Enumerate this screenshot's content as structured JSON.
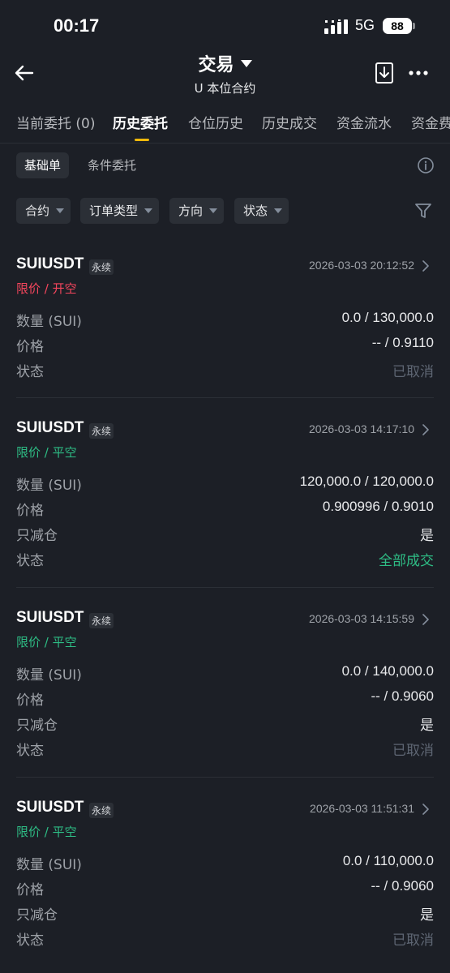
{
  "status_bar": {
    "time": "00:17",
    "network": "5G",
    "battery": "88"
  },
  "header": {
    "title": "交易",
    "subtitle": "U 本位合约"
  },
  "tabs": [
    {
      "label": "当前委托 (0)"
    },
    {
      "label": "历史委托"
    },
    {
      "label": "仓位历史"
    },
    {
      "label": "历史成交"
    },
    {
      "label": "资金流水"
    },
    {
      "label": "资金费"
    }
  ],
  "subtabs": [
    {
      "label": "基础单"
    },
    {
      "label": "条件委托"
    }
  ],
  "filters": [
    {
      "label": "合约"
    },
    {
      "label": "订单类型"
    },
    {
      "label": "方向"
    },
    {
      "label": "状态"
    }
  ],
  "labels": {
    "qty": "数量 (SUI)",
    "price": "价格",
    "reduce_only": "只减仓",
    "status": "状态"
  },
  "orders": [
    {
      "symbol": "SUIUSDT",
      "badge": "永续",
      "time": "2026-03-03 20:12:52",
      "type": "限价 / 开空",
      "type_color": "#f6465d",
      "qty": "0.0 / 130,000.0",
      "price": "-- / 0.9110",
      "reduce_only": "",
      "status": "已取消"
    },
    {
      "symbol": "SUIUSDT",
      "badge": "永续",
      "time": "2026-03-03 14:17:10",
      "type": "限价 / 平空",
      "type_color": "#2ebd85",
      "qty": "120,000.0 / 120,000.0",
      "price": "0.900996 / 0.9010",
      "reduce_only": "是",
      "status": "全部成交"
    },
    {
      "symbol": "SUIUSDT",
      "badge": "永续",
      "time": "2026-03-03 14:15:59",
      "type": "限价 / 平空",
      "type_color": "#2ebd85",
      "qty": "0.0 / 140,000.0",
      "price": "-- / 0.9060",
      "reduce_only": "是",
      "status": "已取消"
    },
    {
      "symbol": "SUIUSDT",
      "badge": "永续",
      "time": "2026-03-03 11:51:31",
      "type": "限价 / 平空",
      "type_color": "#2ebd85",
      "qty": "0.0 / 110,000.0",
      "price": "-- / 0.9060",
      "reduce_only": "是",
      "status": "已取消"
    }
  ],
  "colors": {
    "background": "#1c1f26",
    "accent": "#f0b90b",
    "sell": "#f6465d",
    "buy": "#2ebd85",
    "muted": "#5e6673"
  }
}
